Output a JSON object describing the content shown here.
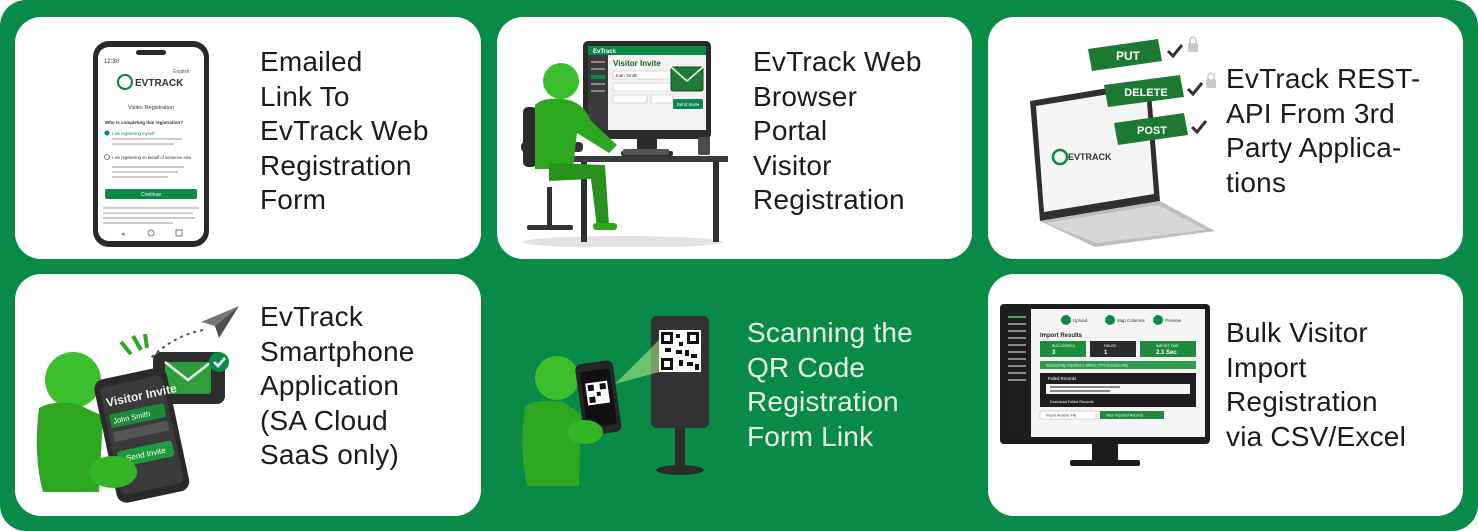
{
  "cards": [
    {
      "id": "emailed-link",
      "lines": [
        "Emailed",
        "Link To",
        "EvTrack Web",
        "Registration",
        "Form"
      ],
      "phone": {
        "time": "12:30",
        "lang": "English",
        "brand": "EVTRACK",
        "title": "Visitor Registration",
        "question": "Who is completing this registration?",
        "opt1": "I am registering myself",
        "opt2": "I am registering on behalf of someone else",
        "button": "Continue"
      }
    },
    {
      "id": "web-portal",
      "lines": [
        "EvTrack Web",
        "Browser",
        "Portal",
        "Visitor",
        "Registration"
      ],
      "screen": {
        "brand": "EvTrack",
        "title": "Visitor Invite",
        "name": "Juan Smith",
        "button": "Send Invite"
      }
    },
    {
      "id": "rest-api",
      "lines": [
        "EvTrack REST-",
        "API From 3rd",
        "Party Applica-",
        "tions"
      ],
      "api": {
        "put": "PUT",
        "delete": "DELETE",
        "post": "POST",
        "brand": "EVTRACK"
      }
    },
    {
      "id": "smartphone-app",
      "lines": [
        "EvTrack",
        "Smartphone",
        "Application",
        "(SA Cloud",
        "SaaS only)"
      ],
      "phone": {
        "title": "Visitor Invite",
        "name": "John Smith",
        "button": "Send Invite"
      }
    },
    {
      "id": "qr-code",
      "lines": [
        "Scanning the",
        "QR Code",
        "Registration",
        "Form Link"
      ]
    },
    {
      "id": "bulk-import",
      "lines": [
        "Bulk Visitor",
        "Import",
        "Registration",
        "via CSV/Excel"
      ],
      "monitor": {
        "steps": [
          "Upload",
          "Map Columns",
          "Preview"
        ],
        "heading": "Import Results",
        "successful_label": "SUCCESSFUL",
        "successful": "3",
        "failed_label": "FAILED",
        "failed": "1",
        "time_label": "IMPORT TIME",
        "time": "2.1 Sec",
        "banner": "Successfully imported 3 visitors (75% success rate)",
        "failed_records": "Failed Records",
        "download": "Download Failed Records",
        "import_another": "Import Another File",
        "view_imported": "View Imported Records"
      }
    }
  ],
  "colors": {
    "brand_green": "#0a8a47",
    "figure_green": "#3bbf2c",
    "text_dark": "#1b1b1b",
    "text_on_green": "#e6f4ea"
  }
}
